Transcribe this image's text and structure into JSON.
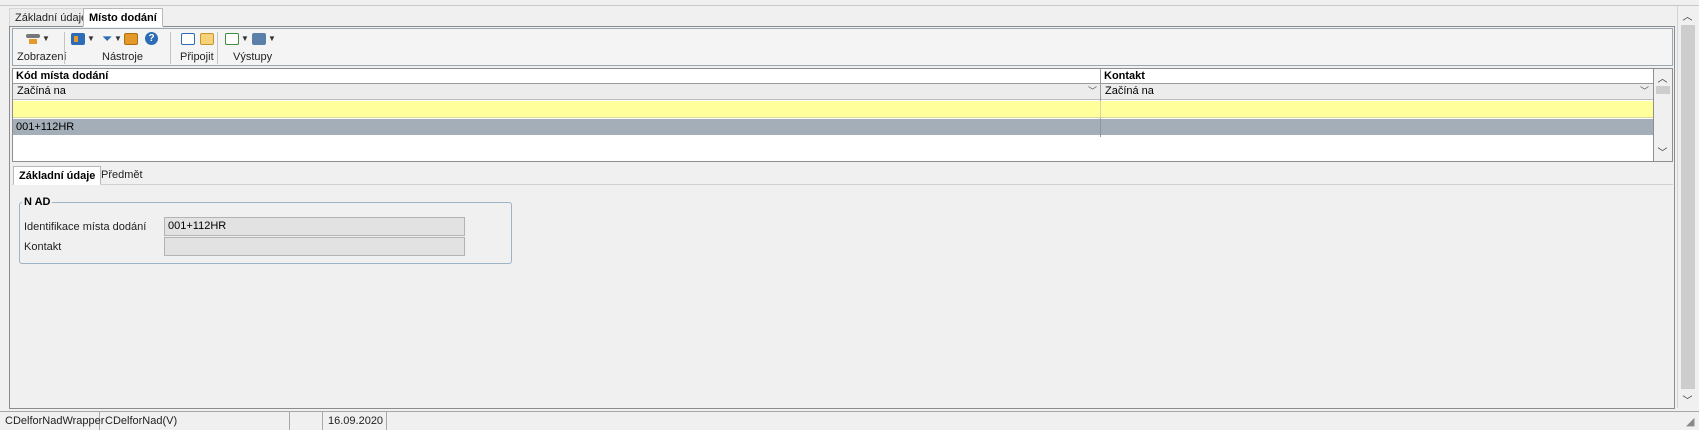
{
  "outer_tabs": [
    {
      "label": "Základní údaje",
      "active": false
    },
    {
      "label": "Místo dodání",
      "active": true
    }
  ],
  "toolbar": {
    "groups": [
      {
        "label": "Zobrazení",
        "icons": [
          "display-mode-icon"
        ]
      },
      {
        "label": "Nástroje",
        "icons": [
          "columns-icon",
          "filter-icon",
          "calendar-icon",
          "help-icon"
        ]
      },
      {
        "label": "Připojit",
        "icons": [
          "edit-note-icon",
          "attach-list-icon"
        ]
      },
      {
        "label": "Výstupy",
        "icons": [
          "export-icon",
          "print-icon"
        ]
      }
    ],
    "colors": {
      "blue": "#2d6db5",
      "orange": "#e39a2b",
      "green": "#3f8f3f",
      "gray": "#777777"
    }
  },
  "grid": {
    "columns": [
      "Kód místa dodání",
      "Kontakt"
    ],
    "filters": [
      "Začíná na",
      "Začíná na"
    ],
    "rows": [
      [
        "001+112HR",
        ""
      ]
    ],
    "colors": {
      "new_row": "#ffff9c",
      "selected_row": "#a3aeb8"
    }
  },
  "detail_tabs": [
    {
      "label": "Základní údaje",
      "active": true
    },
    {
      "label": "Předmět",
      "active": false
    }
  ],
  "form": {
    "group_title": "N AD",
    "fields": [
      {
        "label": "Identifikace místa dodání",
        "value": "001+112HR"
      },
      {
        "label": "Kontakt",
        "value": ""
      }
    ]
  },
  "statusbar": {
    "cells": [
      "CDelforNadWrapper",
      "CDelforNad(V)",
      "",
      "16.09.2020",
      ""
    ]
  }
}
